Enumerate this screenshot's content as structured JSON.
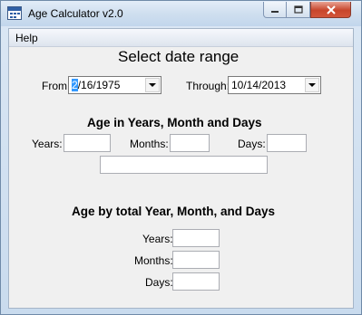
{
  "window": {
    "title": "Age Calculator v2.0",
    "icon": "calendar-icon"
  },
  "menu": {
    "help": "Help"
  },
  "select_range": {
    "heading": "Select date range",
    "from_label": "From:",
    "from_value_highlight": "2",
    "from_value_rest": "/16/1975",
    "through_label": "Through:",
    "through_value": "10/14/2013"
  },
  "ymd": {
    "heading": "Age in Years, Month and Days",
    "years_label": "Years:",
    "months_label": "Months:",
    "days_label": "Days:",
    "years_value": "",
    "months_value": "",
    "days_value": "",
    "summary_value": ""
  },
  "total": {
    "heading": "Age by total Year, Month, and Days",
    "years_label": "Years:",
    "months_label": "Months:",
    "days_label": "Days:",
    "years_value": "",
    "months_value": "",
    "days_value": ""
  }
}
